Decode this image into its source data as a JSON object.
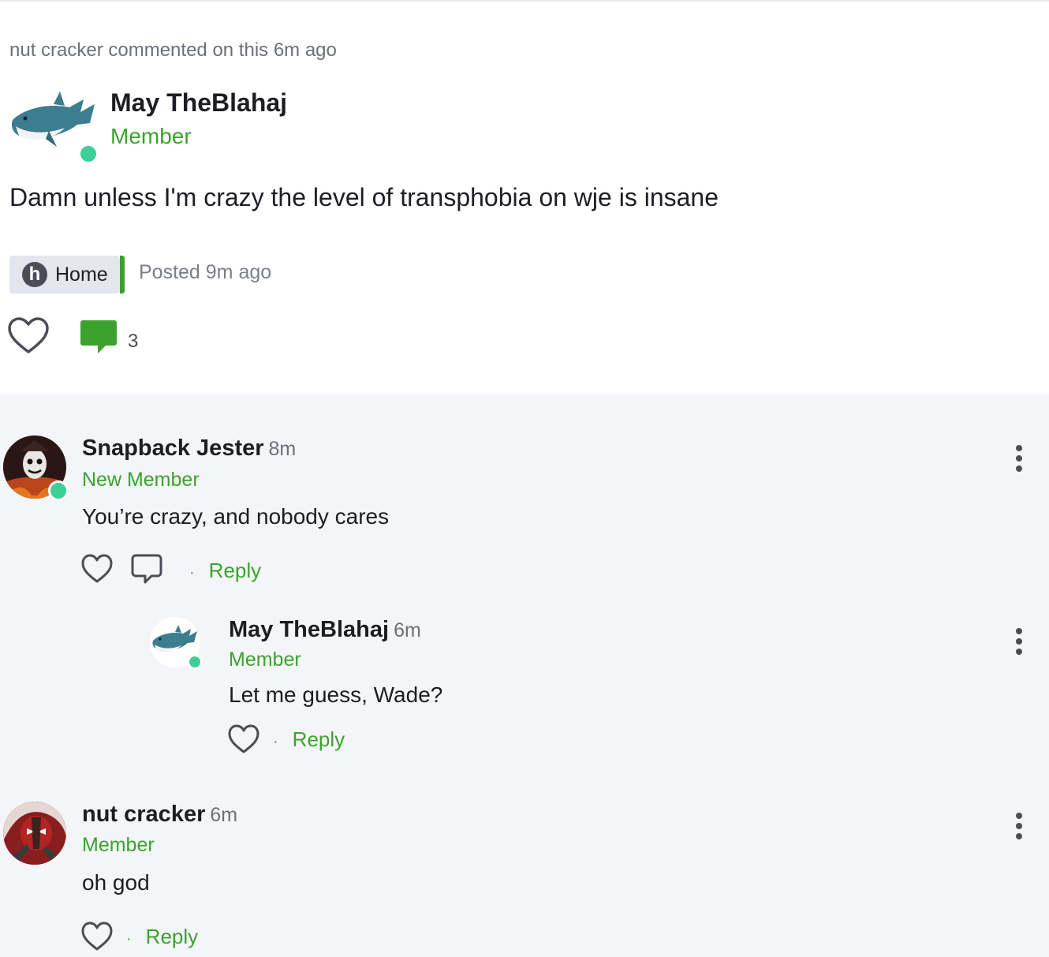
{
  "post": {
    "activity_text": "nut cracker commented on this 6m ago",
    "author": "May TheBlahaj",
    "role": "Member",
    "body": "Damn unless I'm crazy the level of transphobia on wje is insane",
    "space": {
      "icon_letter": "h",
      "label": "Home"
    },
    "posted_text": "Posted 9m ago",
    "comment_count": "3"
  },
  "comments": [
    {
      "author": "Snapback Jester",
      "time": "8m",
      "role": "New Member",
      "text": "You’re crazy, and nobody cares",
      "reply_label": "Reply"
    },
    {
      "author": "May TheBlahaj",
      "time": "6m",
      "role": "Member",
      "text": "Let me guess, Wade?",
      "reply_label": "Reply"
    },
    {
      "author": "nut cracker",
      "time": "6m",
      "role": "Member",
      "text": "oh god",
      "reply_label": "Reply"
    }
  ],
  "colors": {
    "accent_green": "#3ca22e",
    "online_dot": "#3ecf98",
    "comment_bg": "#f3f5f9"
  },
  "icons": [
    "shark-avatar",
    "heart-icon",
    "comment-bubble-icon",
    "kebab-menu-icon",
    "space-h-icon"
  ]
}
